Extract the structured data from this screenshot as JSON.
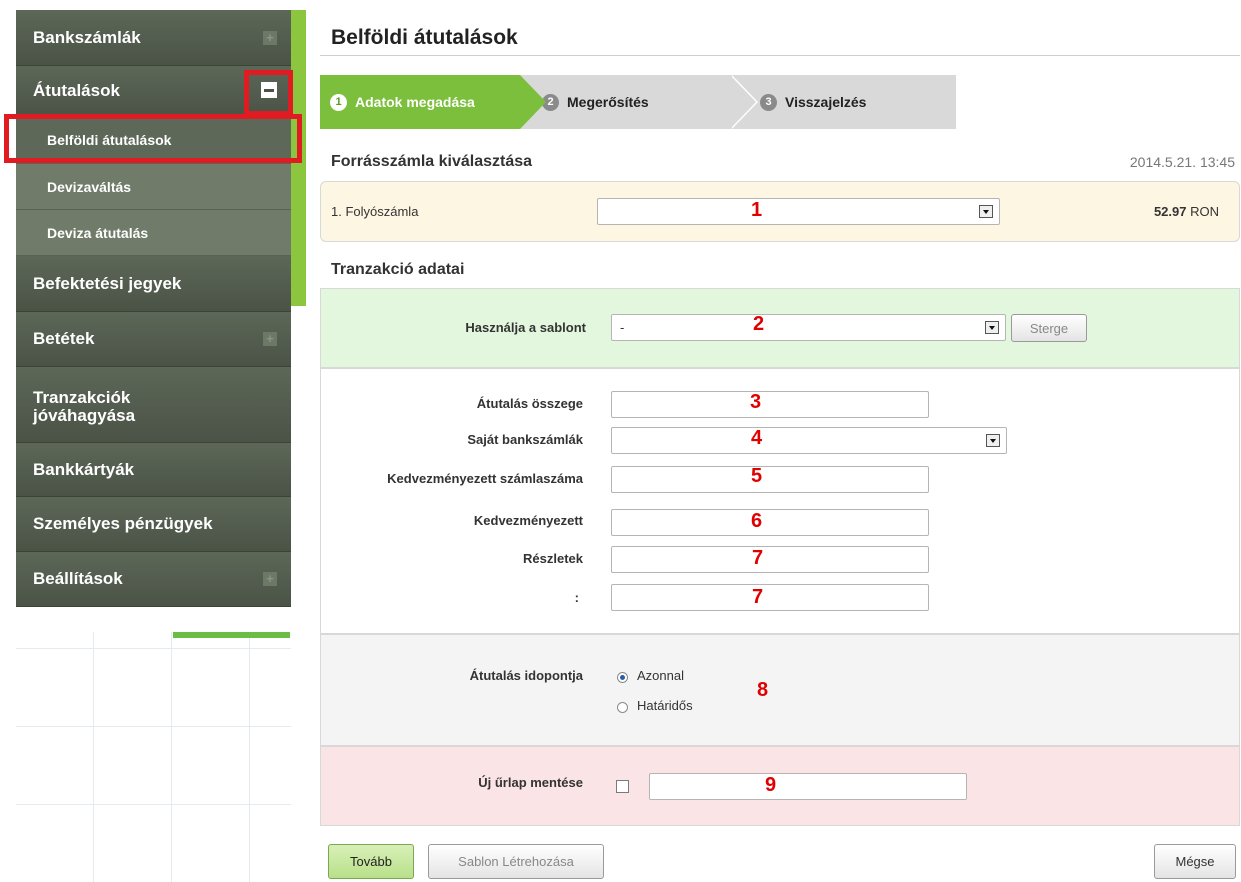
{
  "sidebar": {
    "items": [
      {
        "label": "Bankszámlák"
      },
      {
        "label": "Átutalások"
      },
      {
        "label": "Befektetési jegyek"
      },
      {
        "label": "Betétek"
      },
      {
        "label": "Tranzakciók jóváhagyása"
      },
      {
        "label": "Bankkártyák"
      },
      {
        "label": "Személyes pénzügyek"
      },
      {
        "label": "Beállítások"
      }
    ],
    "sub_items": [
      {
        "label": "Belföldi átutalások"
      },
      {
        "label": "Devizaváltás"
      },
      {
        "label": "Deviza átutalás"
      }
    ]
  },
  "page": {
    "title": "Belföldi átutalások",
    "timestamp": "2014.5.21. 13:45"
  },
  "steps": [
    {
      "num": "1",
      "label": "Adatok megadása"
    },
    {
      "num": "2",
      "label": "Megerősítés"
    },
    {
      "num": "3",
      "label": "Visszajelzés"
    }
  ],
  "source": {
    "section_title": "Forrásszámla kiválasztása",
    "account_label": "1. Folyószámla",
    "balance_amount": "52.97",
    "balance_currency": "RON"
  },
  "transaction": {
    "section_title": "Tranzakció adatai",
    "template_label": "Használja a sablont",
    "template_value": "-",
    "delete_button": "Sterge",
    "amount_label": "Átutalás összege",
    "own_accounts_label": "Saját bankszámlák",
    "beneficiary_account_label": "Kedvezményezett számlaszáma",
    "beneficiary_label": "Kedvezményezett",
    "details_label": "Részletek",
    "details2_label": ":",
    "timing_label": "Átutalás idopontja",
    "timing_options": [
      "Azonnal",
      "Határidős"
    ],
    "save_form_label": "Új űrlap mentése"
  },
  "markers": [
    "1",
    "2",
    "3",
    "4",
    "5",
    "6",
    "7",
    "7",
    "8",
    "9"
  ],
  "buttons": {
    "next": "Tovább",
    "create_template": "Sablon Létrehozása",
    "cancel": "Mégse"
  },
  "colors": {
    "accent_green": "#7bbf3d",
    "annotation_red": "#e01b22"
  }
}
